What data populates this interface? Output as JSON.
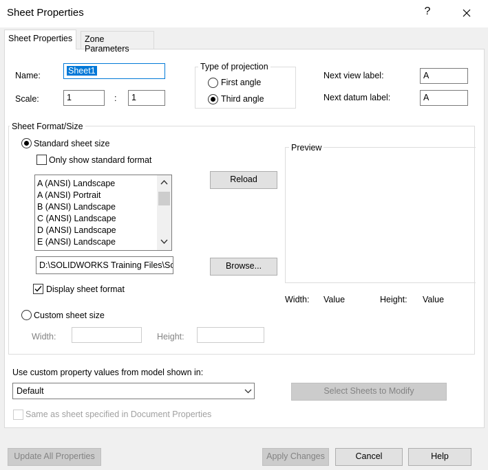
{
  "window": {
    "title": "Sheet Properties",
    "help_glyph": "?"
  },
  "tabs": [
    {
      "label": "Sheet Properties",
      "active": true
    },
    {
      "label": "Zone Parameters",
      "active": false
    }
  ],
  "name": {
    "label": "Name:",
    "value": "Sheet1"
  },
  "scale": {
    "label": "Scale:",
    "numerator": "1",
    "separator": ":",
    "denominator": "1"
  },
  "projection": {
    "title": "Type of projection",
    "options": [
      {
        "label": "First angle",
        "selected": false
      },
      {
        "label": "Third angle",
        "selected": true
      }
    ]
  },
  "labels": {
    "next_view_label": "Next view label:",
    "next_view_value": "A",
    "next_datum_label": "Next datum label:",
    "next_datum_value": "A"
  },
  "sheet_format": {
    "title": "Sheet Format/Size",
    "standard_size_label": "Standard sheet size",
    "standard_size_selected": true,
    "only_standard_label": "Only show standard format",
    "only_standard_checked": false,
    "sizes": [
      "A (ANSI) Landscape",
      "A (ANSI) Portrait",
      "B (ANSI) Landscape",
      "C (ANSI) Landscape",
      "D (ANSI) Landscape",
      "E (ANSI) Landscape"
    ],
    "reload_label": "Reload",
    "path_value": "D:\\SOLIDWORKS Training Files\\Sc",
    "browse_label": "Browse...",
    "display_format_label": "Display sheet format",
    "display_format_checked": true,
    "custom_size_label": "Custom sheet size",
    "custom_size_selected": false,
    "custom_width_label": "Width:",
    "custom_height_label": "Height:"
  },
  "preview": {
    "title": "Preview",
    "width_label": "Width:",
    "width_value": "Value",
    "height_label": "Height:",
    "height_value": "Value"
  },
  "custom_property": {
    "label": "Use custom property values from model shown in:",
    "dropdown_value": "Default",
    "select_sheets_label": "Select Sheets to Modify",
    "same_as_label": "Same as sheet specified in Document Properties",
    "same_as_checked": false
  },
  "footer": {
    "update_all_label": "Update All Properties",
    "apply_label": "Apply Changes",
    "cancel_label": "Cancel",
    "help_label": "Help"
  }
}
